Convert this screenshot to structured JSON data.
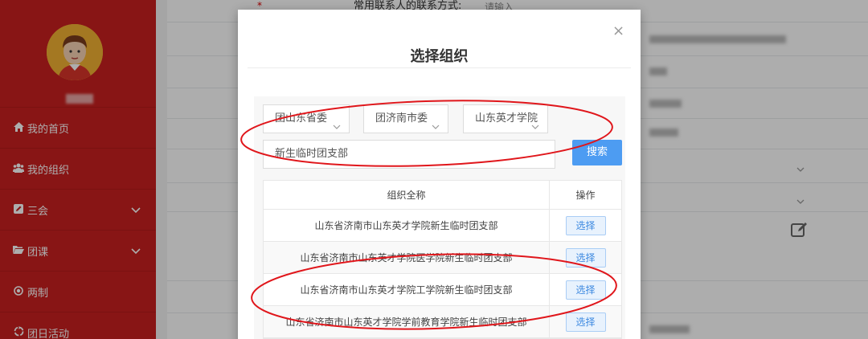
{
  "sidebar": {
    "items": [
      {
        "icon": "home-icon",
        "label": "我的首页"
      },
      {
        "icon": "users-icon",
        "label": "我的组织"
      },
      {
        "icon": "edit-square-icon",
        "label": "三会"
      },
      {
        "icon": "folder-icon",
        "label": "团课"
      },
      {
        "icon": "circle-dot-icon",
        "label": "两制"
      },
      {
        "icon": "recycle-icon",
        "label": "团日活动"
      }
    ]
  },
  "background_form": {
    "contact_label": "常用联系人的联系方式:",
    "contact_placeholder": "请输入"
  },
  "modal": {
    "title": "选择组织",
    "close": "×",
    "select_1": "团山东省委",
    "select_2": "团济南市委",
    "select_3": "山东英才学院",
    "search_value": "新生临时团支部",
    "search_button": "搜索",
    "table": {
      "col_name": "组织全称",
      "col_op": "操作",
      "rows": [
        {
          "name": "山东省济南市山东英才学院新生临时团支部",
          "action": "选择"
        },
        {
          "name": "山东省济南市山东英才学院医学院新生临时团支部",
          "action": "选择"
        },
        {
          "name": "山东省济南市山东英才学院工学院新生临时团支部",
          "action": "选择"
        },
        {
          "name": "山东省济南市山东英才学院学前教育学院新生临时团支部",
          "action": "选择"
        }
      ]
    }
  },
  "colors": {
    "sidebar": "#c9201f",
    "primary_button": "#4d9cf2",
    "annotation": "#e0161b"
  }
}
